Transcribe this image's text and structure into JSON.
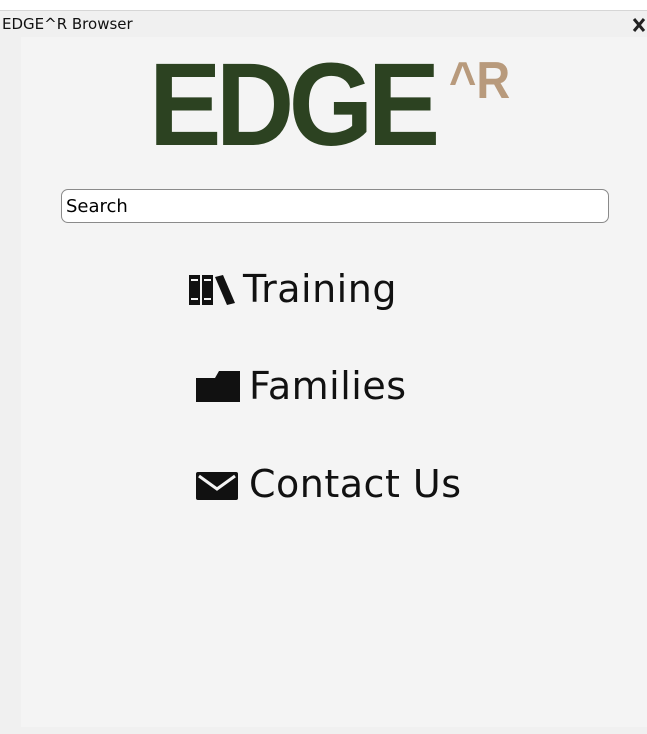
{
  "window": {
    "title": "EDGE^R Browser",
    "close_label": "✕"
  },
  "logo": {
    "main": "EDGE",
    "superscript": "^R",
    "main_color": "#2c4221",
    "superscript_color": "#b89a7c"
  },
  "search": {
    "placeholder": "Search",
    "value": ""
  },
  "nav": {
    "items": [
      {
        "label": "Training",
        "icon": "books-icon"
      },
      {
        "label": "Families",
        "icon": "folder-icon"
      },
      {
        "label": "Contact Us",
        "icon": "envelope-icon"
      }
    ]
  }
}
